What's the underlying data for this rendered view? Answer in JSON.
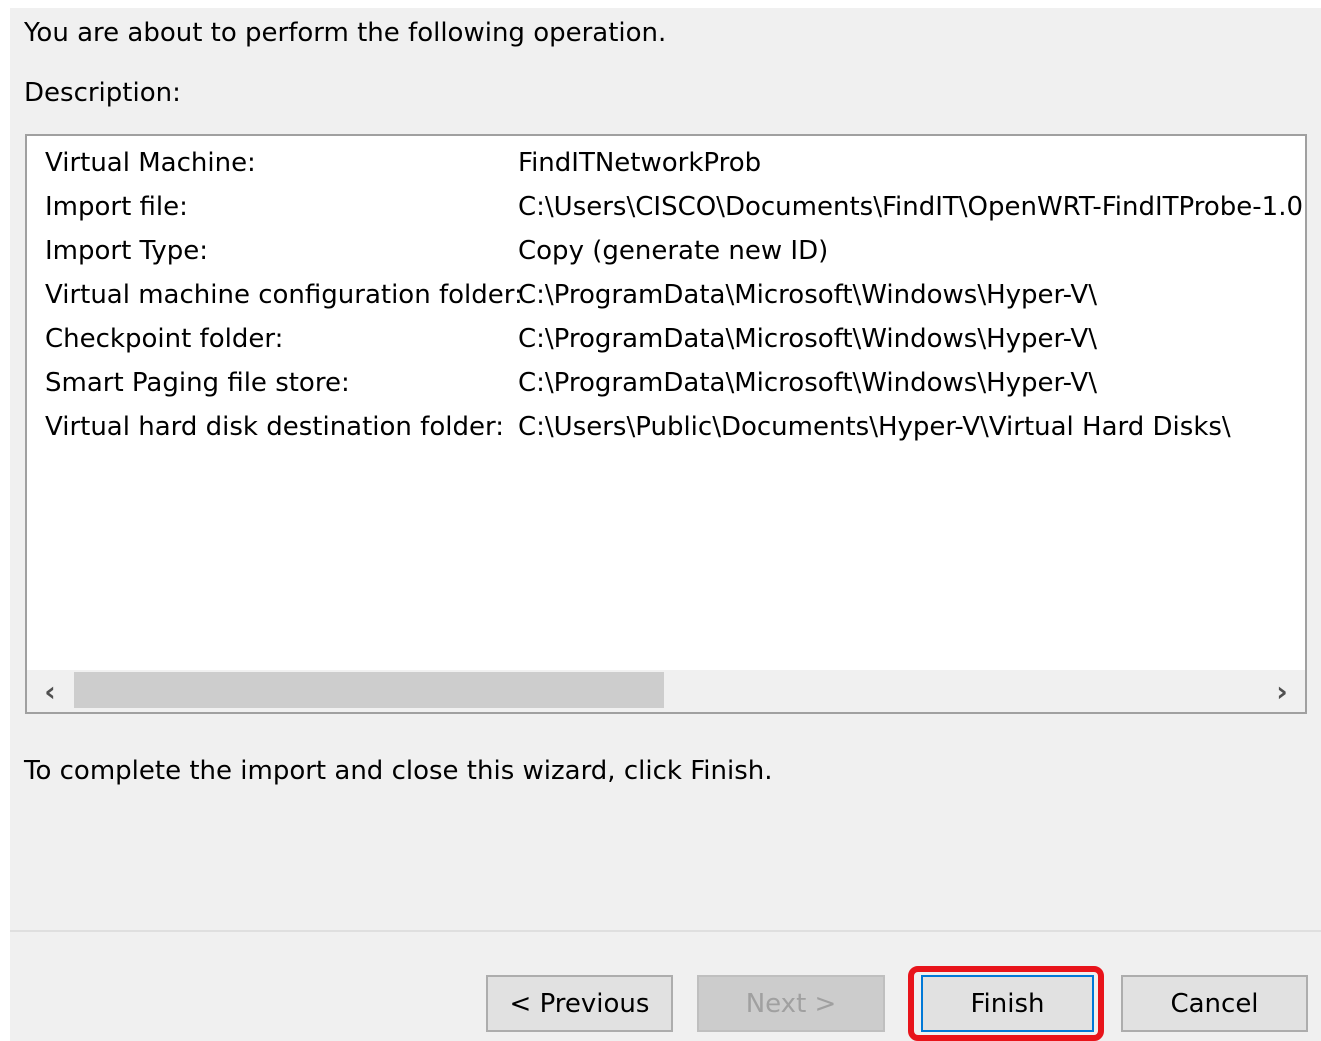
{
  "intro_text": "You are about to perform the following operation.",
  "description_label": "Description:",
  "summary": [
    {
      "label": "Virtual Machine:",
      "value": "FindITNetworkProb"
    },
    {
      "label": "Import file:",
      "value": "C:\\Users\\CISCO\\Documents\\FindIT\\OpenWRT-FindITProbe-1.0"
    },
    {
      "label": "Import Type:",
      "value": "Copy (generate new ID)"
    },
    {
      "label": "Virtual machine configuration folder:",
      "value": "C:\\ProgramData\\Microsoft\\Windows\\Hyper-V\\"
    },
    {
      "label": "Checkpoint folder:",
      "value": "C:\\ProgramData\\Microsoft\\Windows\\Hyper-V\\"
    },
    {
      "label": "Smart Paging file store:",
      "value": "C:\\ProgramData\\Microsoft\\Windows\\Hyper-V\\"
    },
    {
      "label": "Virtual hard disk destination folder:",
      "value": "C:\\Users\\Public\\Documents\\Hyper-V\\Virtual Hard Disks\\"
    }
  ],
  "scrollbar": {
    "left_arrow_icon": "chevron-left-icon",
    "right_arrow_icon": "chevron-right-icon",
    "left_glyph": "‹",
    "right_glyph": "›"
  },
  "complete_text": "To complete the import and close this wizard, click Finish.",
  "buttons": {
    "previous": "< Previous",
    "next": "Next >",
    "finish": "Finish",
    "cancel": "Cancel"
  },
  "colors": {
    "highlight": "#e8141b",
    "focus_border": "#0078d7"
  }
}
